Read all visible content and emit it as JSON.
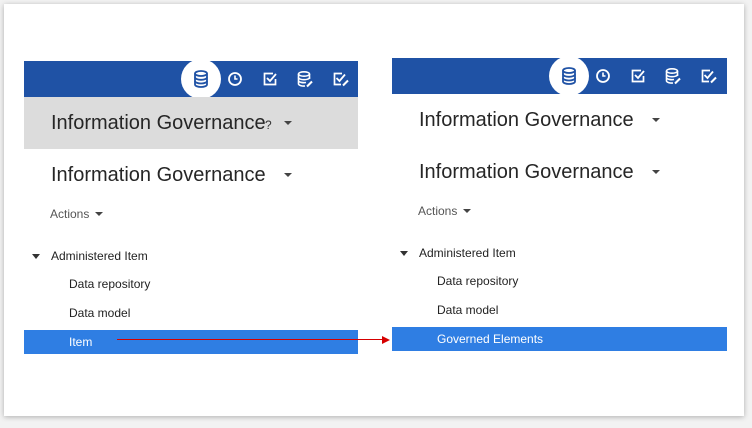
{
  "colors": {
    "topbar": "#1f52a5",
    "selected_row": "#2f7ee3",
    "header_gray": "#dcdcdc",
    "arrow": "#d60000"
  },
  "toolbar_icons": [
    "database-icon",
    "clock-icon",
    "checkbox-icon",
    "database-edit-icon",
    "checklist-edit-icon"
  ],
  "left_panel": {
    "header_title": "Information Governance",
    "help_mark": "?",
    "subheader_title": "Information Governance",
    "actions_label": "Actions",
    "tree": {
      "root_label": "Administered Item",
      "items": [
        "Data repository",
        "Data model",
        "Item"
      ],
      "selected_item": "Item"
    }
  },
  "right_panel": {
    "header_title": "Information Governance",
    "subheader_title": "Information Governance",
    "actions_label": "Actions",
    "tree": {
      "root_label": "Administered Item",
      "items": [
        "Data repository",
        "Data model",
        "Governed Elements"
      ],
      "selected_item": "Governed Elements"
    }
  }
}
